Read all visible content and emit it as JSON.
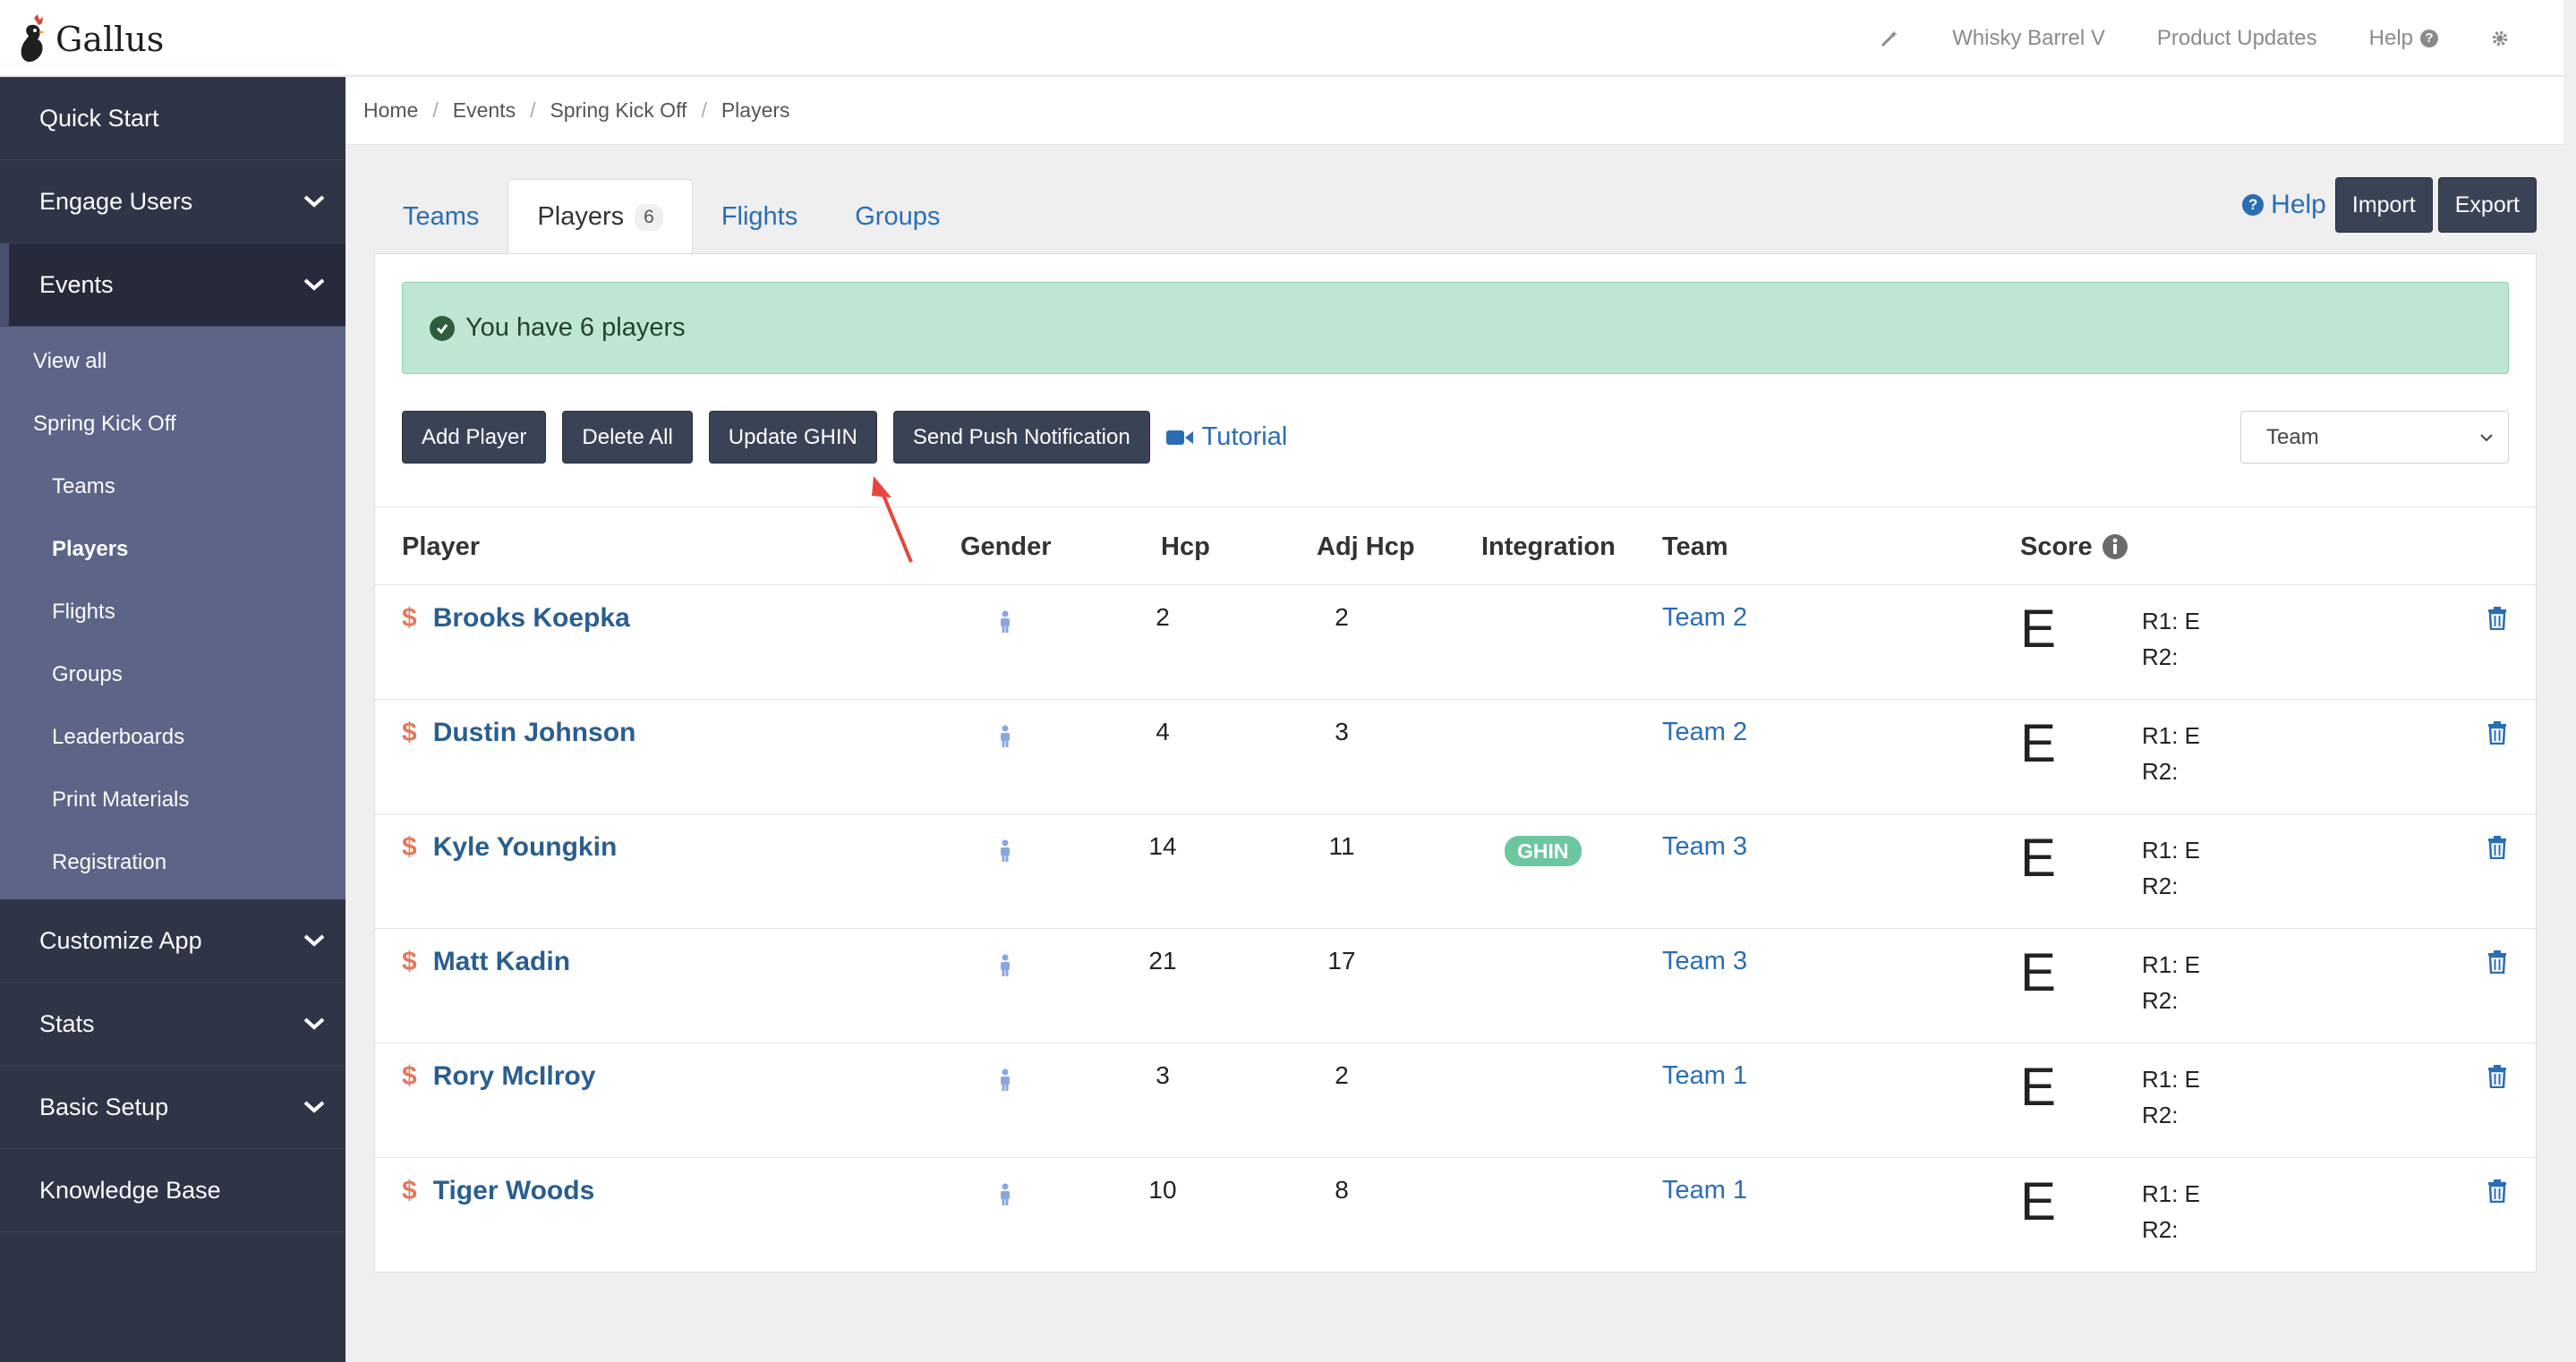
{
  "app": {
    "name": "Gallus",
    "topnav": {
      "wand_icon": "magic-wand-icon",
      "org": "Whisky Barrel V",
      "updates": "Product Updates",
      "help": "Help",
      "settings_icon": "gear-icon"
    }
  },
  "sidebar": {
    "quick_start": "Quick Start",
    "engage_users": "Engage Users",
    "events": "Events",
    "events_sub": {
      "view_all": "View all",
      "event_name": "Spring Kick Off",
      "teams": "Teams",
      "players": "Players",
      "flights": "Flights",
      "groups": "Groups",
      "leaderboards": "Leaderboards",
      "print_materials": "Print Materials",
      "registration": "Registration"
    },
    "customize_app": "Customize App",
    "stats": "Stats",
    "basic_setup": "Basic Setup",
    "knowledge_base": "Knowledge Base"
  },
  "breadcrumb": [
    "Home",
    "Events",
    "Spring Kick Off",
    "Players"
  ],
  "tabs": {
    "teams": "Teams",
    "players": "Players",
    "players_count": "6",
    "flights": "Flights",
    "groups": "Groups"
  },
  "actions": {
    "help": "Help",
    "import": "Import",
    "export": "Export"
  },
  "alert": {
    "message": "You have 6 players"
  },
  "toolbar": {
    "add_player": "Add Player",
    "delete_all": "Delete All",
    "update_ghin": "Update GHIN",
    "send_push": "Send Push Notification",
    "tutorial": "Tutorial",
    "filter_value": "Team"
  },
  "table": {
    "headers": {
      "player": "Player",
      "gender": "Gender",
      "hcp": "Hcp",
      "adj_hcp": "Adj Hcp",
      "integration": "Integration",
      "team": "Team",
      "score": "Score"
    },
    "rows": [
      {
        "name": "Brooks Koepka",
        "hcp": "2",
        "adj": "2",
        "integration": "",
        "team": "Team 2",
        "score": "E",
        "r1": "R1: E",
        "r2": "R2:"
      },
      {
        "name": "Dustin Johnson",
        "hcp": "4",
        "adj": "3",
        "integration": "",
        "team": "Team 2",
        "score": "E",
        "r1": "R1: E",
        "r2": "R2:"
      },
      {
        "name": "Kyle Youngkin",
        "hcp": "14",
        "adj": "11",
        "integration": "GHIN",
        "team": "Team 3",
        "score": "E",
        "r1": "R1: E",
        "r2": "R2:"
      },
      {
        "name": "Matt Kadin",
        "hcp": "21",
        "adj": "17",
        "integration": "",
        "team": "Team 3",
        "score": "E",
        "r1": "R1: E",
        "r2": "R2:"
      },
      {
        "name": "Rory McIlroy",
        "hcp": "3",
        "adj": "2",
        "integration": "",
        "team": "Team 1",
        "score": "E",
        "r1": "R1: E",
        "r2": "R2:"
      },
      {
        "name": "Tiger Woods",
        "hcp": "10",
        "adj": "8",
        "integration": "",
        "team": "Team 1",
        "score": "E",
        "r1": "R1: E",
        "r2": "R2:"
      }
    ],
    "currency_symbol": "$"
  },
  "colors": {
    "sidebar": "#2f3447",
    "sidebar_sub": "#5c6488",
    "link": "#2a6db5",
    "alert_bg": "#bfe6d2",
    "ghin_badge": "#6cc7a0",
    "arrow": "#e8453c"
  }
}
